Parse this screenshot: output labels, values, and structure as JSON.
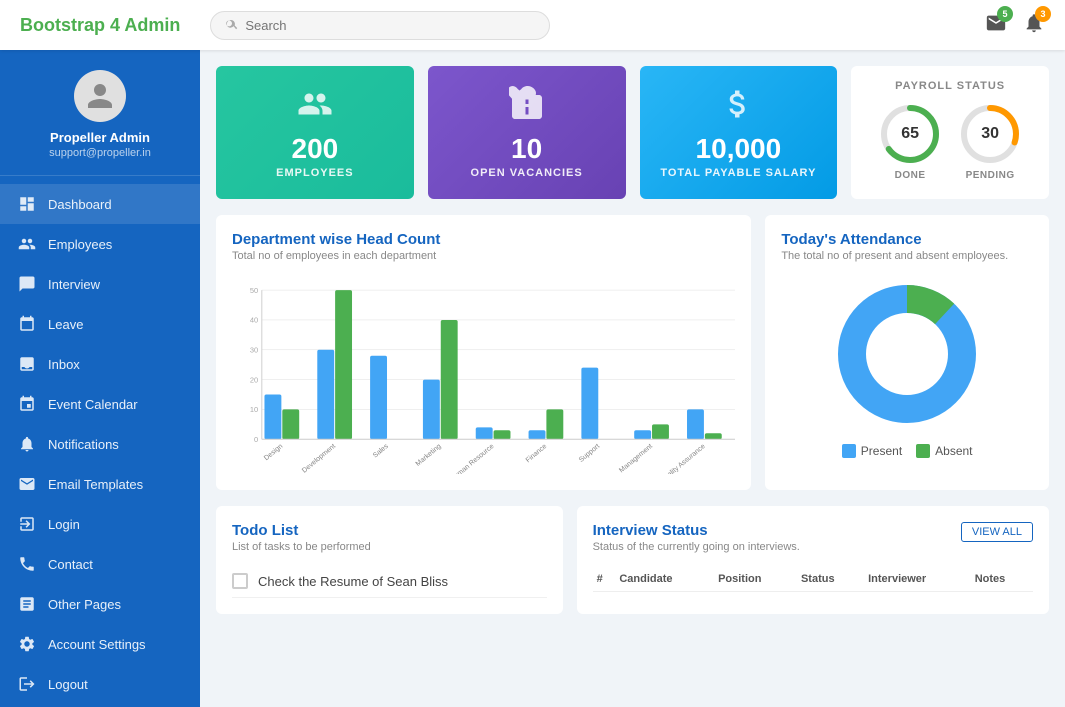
{
  "brand": {
    "name": "Bootstrap 4",
    "highlight": " Admin"
  },
  "search": {
    "placeholder": "Search"
  },
  "nav_icons": {
    "mail_badge": "5",
    "bell_badge": "3"
  },
  "sidebar": {
    "user": {
      "name": "Propeller Admin",
      "email": "support@propeller.in"
    },
    "items": [
      {
        "id": "dashboard",
        "label": "Dashboard"
      },
      {
        "id": "employees",
        "label": "Employees"
      },
      {
        "id": "interview",
        "label": "Interview"
      },
      {
        "id": "leave",
        "label": "Leave"
      },
      {
        "id": "inbox",
        "label": "Inbox"
      },
      {
        "id": "event-calendar",
        "label": "Event Calendar"
      },
      {
        "id": "notifications",
        "label": "Notifications"
      },
      {
        "id": "email-templates",
        "label": "Email Templates"
      },
      {
        "id": "login",
        "label": "Login"
      },
      {
        "id": "contact",
        "label": "Contact"
      },
      {
        "id": "other-pages",
        "label": "Other Pages"
      },
      {
        "id": "account-settings",
        "label": "Account Settings"
      },
      {
        "id": "logout",
        "label": "Logout"
      }
    ]
  },
  "stats": [
    {
      "id": "employees",
      "number": "200",
      "label": "EMPLOYEES",
      "color": "teal"
    },
    {
      "id": "vacancies",
      "number": "10",
      "label": "OPEN VACANCIES",
      "color": "purple"
    },
    {
      "id": "salary",
      "number": "10,000",
      "label": "TOTAL PAYABLE SALARY",
      "color": "blue"
    }
  ],
  "payroll": {
    "title": "PAYROLL STATUS",
    "done_value": "65",
    "done_label": "DONE",
    "pending_value": "30",
    "pending_label": "PENDING",
    "done_pct": 65,
    "pending_pct": 30
  },
  "headcount_chart": {
    "title": "Department wise Head Count",
    "subtitle": "Total no of employees in each department",
    "y_labels": [
      "50",
      "45",
      "40",
      "35",
      "30",
      "25",
      "20",
      "15",
      "10",
      "5",
      "0"
    ],
    "departments": [
      {
        "name": "Design",
        "blue": 15,
        "green": 10
      },
      {
        "name": "Development",
        "blue": 30,
        "green": 50
      },
      {
        "name": "Sales",
        "blue": 28,
        "green": 0
      },
      {
        "name": "Marketing",
        "blue": 20,
        "green": 40
      },
      {
        "name": "Human Resource",
        "blue": 4,
        "green": 3
      },
      {
        "name": "Finance",
        "blue": 3,
        "green": 10
      },
      {
        "name": "Support",
        "blue": 24,
        "green": 0
      },
      {
        "name": "Management",
        "blue": 3,
        "green": 5
      },
      {
        "name": "Quality Assurance",
        "blue": 10,
        "green": 2
      }
    ],
    "max": 50
  },
  "attendance": {
    "title": "Today's Attendance",
    "subtitle": "The total no of present and absent employees.",
    "present_pct": 88,
    "absent_pct": 12,
    "legend_present": "Present",
    "legend_absent": "Absent"
  },
  "todo": {
    "title": "Todo List",
    "subtitle": "List of tasks to be performed",
    "items": [
      {
        "label": "Check the Resume of Sean Bliss",
        "done": false
      }
    ]
  },
  "interview": {
    "title": "Interview Status",
    "subtitle": "Status of the currently going on interviews.",
    "view_all_label": "VIEW ALL",
    "columns": [
      "#",
      "Candidate",
      "Position",
      "Status",
      "Interviewer",
      "Notes"
    ]
  }
}
